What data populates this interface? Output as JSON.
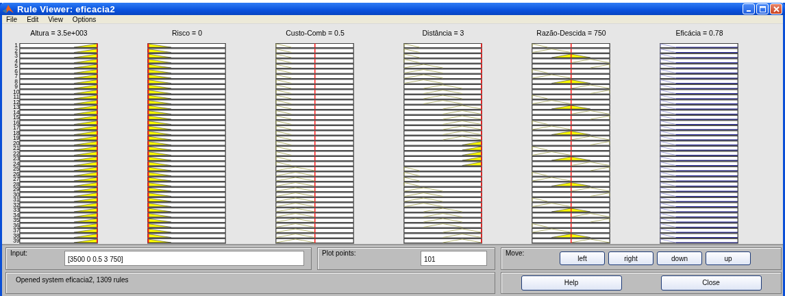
{
  "window": {
    "title": "Rule Viewer: eficacia2"
  },
  "menu": [
    "File",
    "Edit",
    "View",
    "Options"
  ],
  "variables": [
    {
      "label": "Altura = 3.5e+003",
      "kind": "input",
      "level": 1
    },
    {
      "label": "Risco = 0",
      "kind": "input",
      "level": 0
    },
    {
      "label": "Custo-Comb = 0.5",
      "kind": "input",
      "level": 0.5
    },
    {
      "label": "Distância = 3",
      "kind": "input",
      "level": 1
    },
    {
      "label": "Razão-Descida = 750",
      "kind": "input",
      "level": 0.5
    },
    {
      "label": "Eficácia = 0.78",
      "kind": "output"
    }
  ],
  "rules": [
    "1",
    "2",
    "3",
    "4",
    "5",
    "6",
    "7",
    "8",
    "9",
    "10",
    "11",
    "12",
    "13",
    "14",
    "15",
    "16",
    "17",
    "18",
    "19",
    "20",
    "21",
    "22",
    "23",
    "24",
    "25",
    "26",
    "27",
    "28",
    "29",
    "30",
    "31",
    "32",
    "33",
    "34",
    "35",
    "36",
    "37",
    "38",
    "39"
  ],
  "input": {
    "label": "Input:",
    "value": "[3500 0 0.5 3 750]"
  },
  "plot_points": {
    "label": "Plot points:",
    "value": "101"
  },
  "move": {
    "label": "Move:",
    "buttons": [
      "left",
      "right",
      "down",
      "up"
    ]
  },
  "status": "Opened system eficacia2, 1309 rules",
  "buttons": [
    "Help",
    "Close"
  ]
}
